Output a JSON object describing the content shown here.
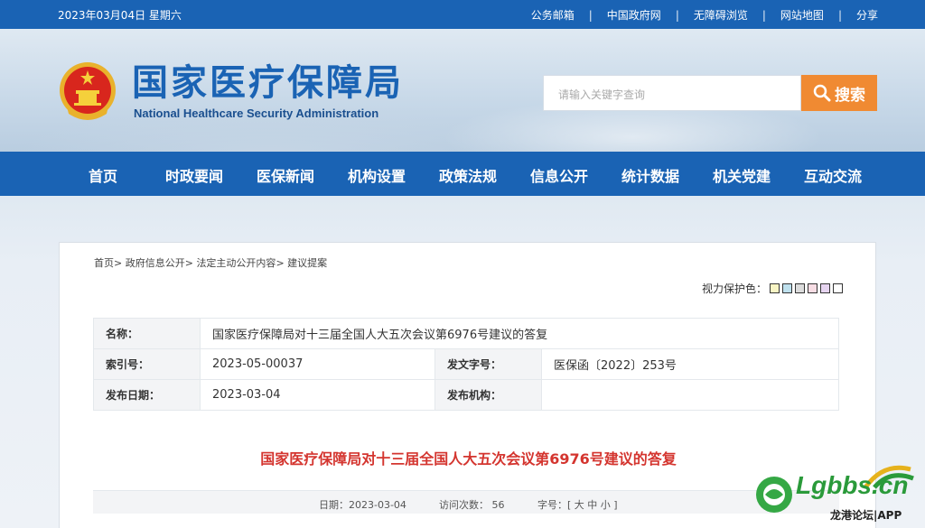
{
  "topbar": {
    "date": "2023年03月04日 星期六",
    "links": [
      "公务邮箱",
      "中国政府网",
      "无障碍浏览",
      "网站地图",
      "分享"
    ],
    "separator": "|"
  },
  "header": {
    "title": "国家医疗保障局",
    "subtitle": "National Healthcare Security Administration",
    "search_placeholder": "请输入关键字查询",
    "search_button": "搜索"
  },
  "nav": {
    "items": [
      "首页",
      "时政要闻",
      "医保新闻",
      "机构设置",
      "政策法规",
      "信息公开",
      "统计数据",
      "机关党建",
      "互动交流"
    ]
  },
  "breadcrumb": {
    "items": [
      "首页",
      "政府信息公开",
      "法定主动公开内容",
      "建议提案"
    ],
    "separator": ">"
  },
  "eye_protect": {
    "label": "视力保护色：",
    "colors": [
      "#f8f5c4",
      "#bfe1ee",
      "#dcdcdc",
      "#f7dde4",
      "#e6d4f0",
      "#ffffff"
    ]
  },
  "meta": {
    "name_label": "名称：",
    "name_value": "国家医疗保障局对十三届全国人大五次会议第6976号建议的答复",
    "index_label": "索引号：",
    "index_value": "2023-05-00037",
    "doc_no_label": "发文字号：",
    "doc_no_value": "医保函〔2022〕253号",
    "date_label": "发布日期：",
    "date_value": "2023-03-04",
    "org_label": "发布机构：",
    "org_value": ""
  },
  "document": {
    "title": "国家医疗保障局对十三届全国人大五次会议第6976号建议的答复"
  },
  "infobar": {
    "date": "日期：2023-03-04",
    "visits": "访问次数： 56",
    "font_label": "字号：[",
    "font_large": "大",
    "font_medium": "中",
    "font_small": "小",
    "font_end": "]"
  },
  "watermark": {
    "brand": "Lgbbs.cn",
    "sub": "龙港论坛|APP"
  },
  "colors": {
    "primary_blue": "#1a63b4",
    "search_orange": "#f08a32",
    "title_red": "#d4352f"
  }
}
